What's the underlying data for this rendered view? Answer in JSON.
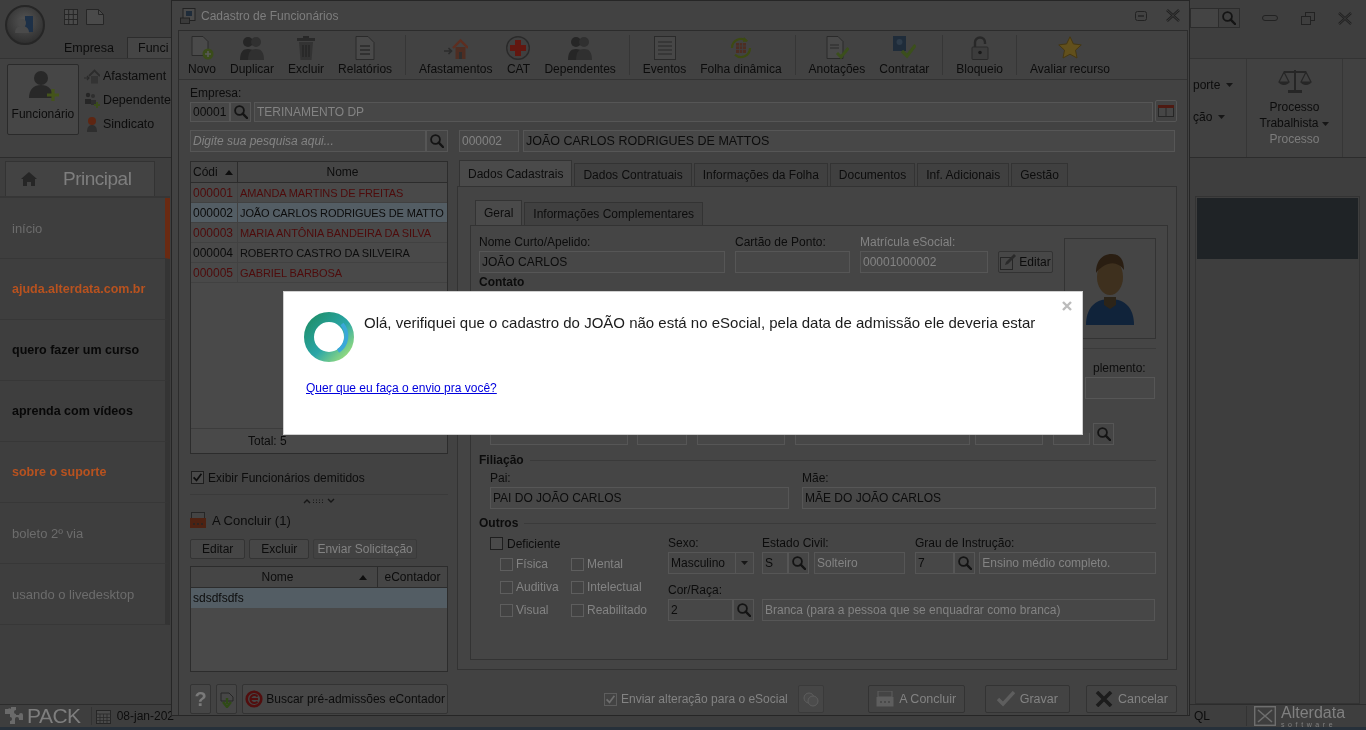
{
  "app": {
    "ribbon_tabs": [
      {
        "label": "Empresa",
        "selected": false
      },
      {
        "label": "Funci",
        "selected": true
      }
    ],
    "ribbon_left": {
      "main_button": "Funcionário",
      "items": [
        {
          "label": "Afastament",
          "kind": "leave"
        },
        {
          "label": "Dependente",
          "kind": "dependents"
        },
        {
          "label": "Sindicato",
          "kind": "union"
        }
      ]
    },
    "ribbon_right": {
      "menus": [
        "porte",
        "ção"
      ],
      "process_button": "Processo Trabalhista",
      "group_label": "Processo"
    },
    "page_tab": "Principal",
    "sidebar": {
      "items": [
        {
          "label": "início",
          "kind": "plain",
          "selected": true
        },
        {
          "label": "ajuda.alterdata.com.br",
          "kind": "accent",
          "selected": false
        },
        {
          "label": "quero fazer um curso",
          "kind": "bold",
          "selected": false
        },
        {
          "label": "aprenda com vídeos",
          "kind": "bold",
          "selected": false
        },
        {
          "label": "sobre o suporte",
          "kind": "accent",
          "selected": false
        },
        {
          "label": "boleto 2º via",
          "kind": "plain",
          "selected": false
        },
        {
          "label": "usando o livedesktop",
          "kind": "plain",
          "selected": false
        }
      ]
    },
    "status_bar": {
      "product": "PACK",
      "date": "08-jan-202",
      "database": "QL",
      "brand": "Alterdata",
      "brand_tagline": "software"
    }
  },
  "window": {
    "title": "Cadastro de Funcionários",
    "toolbar": [
      [
        {
          "label": "Novo",
          "kind": "new"
        },
        {
          "label": "Duplicar",
          "kind": "duplicate"
        },
        {
          "label": "Excluir",
          "kind": "delete"
        },
        {
          "label": "Relatórios",
          "kind": "report"
        }
      ],
      [
        {
          "label": "Afastamentos",
          "kind": "leave"
        },
        {
          "label": "CAT",
          "kind": "cat"
        },
        {
          "label": "Dependentes",
          "kind": "dependents"
        }
      ],
      [
        {
          "label": "Eventos",
          "kind": "events"
        },
        {
          "label": "Folha dinâmica",
          "kind": "payroll"
        }
      ],
      [
        {
          "label": "Anotações",
          "kind": "notes"
        },
        {
          "label": "Contratar",
          "kind": "hire"
        }
      ],
      [
        {
          "label": "Bloqueio",
          "kind": "lock"
        }
      ],
      [
        {
          "label": "Avaliar recurso",
          "kind": "rate"
        }
      ]
    ],
    "company": {
      "label": "Empresa:",
      "code": "00001",
      "name": "TERINAMENTO DP"
    },
    "search": {
      "placeholder": "Digite sua pesquisa aqui..."
    },
    "employees": {
      "columns": [
        {
          "label": "Códi",
          "sorted": true
        },
        {
          "label": "Nome",
          "sorted": false
        }
      ],
      "rows": [
        {
          "code": "000001",
          "name": "AMANDA MARTINS DE FREITAS",
          "color": "#4e0b0b",
          "selected": false
        },
        {
          "code": "000002",
          "name": "JOÃO CARLOS RODRIGUES DE MATTO",
          "color": "#0c0c0c",
          "selected": true
        },
        {
          "code": "000003",
          "name": "MARIA ANTÔNIA BANDEIRA DA SILVA",
          "color": "#4e0b0b",
          "selected": false
        },
        {
          "code": "000004",
          "name": "ROBERTO CASTRO DA SILVEIRA",
          "color": "#0c0c0c",
          "selected": false
        },
        {
          "code": "000005",
          "name": "GABRIEL BARBOSA",
          "color": "#4e0b0b",
          "selected": false
        }
      ],
      "total": "Total: 5"
    },
    "show_dismissed": {
      "label": "Exibir Funcionários demitidos",
      "checked": true
    },
    "pending": {
      "title": "A Concluir (1)",
      "buttons": [
        {
          "label": "Editar",
          "disabled": false
        },
        {
          "label": "Excluir",
          "disabled": false
        },
        {
          "label": "Enviar Solicitação",
          "disabled": true
        }
      ],
      "columns": [
        {
          "label": "Nome",
          "sorted": true
        },
        {
          "label": "eContador",
          "sorted": false
        }
      ],
      "rows": [
        {
          "name": "sdsdfsdfs",
          "selected": true
        }
      ]
    },
    "help_button": "?",
    "fetch_button": "Buscar pré-admissões eContador",
    "employee": {
      "code": "000002",
      "name": "JOÃO CARLOS RODRIGUES DE MATTOS"
    },
    "tabs": [
      {
        "label": "Dados Cadastrais",
        "selected": true
      },
      {
        "label": "Dados Contratuais",
        "selected": false
      },
      {
        "label": "Informações da Folha",
        "selected": false
      },
      {
        "label": "Documentos",
        "selected": false
      },
      {
        "label": "Inf. Adicionais",
        "selected": false
      },
      {
        "label": "Gestão",
        "selected": false
      }
    ],
    "subtabs": [
      {
        "label": "Geral",
        "selected": true
      },
      {
        "label": "Informações Complementares",
        "selected": false
      }
    ],
    "form": {
      "nickname": {
        "label": "Nome Curto/Apelido:",
        "value": "JOÃO CARLOS"
      },
      "time_card": {
        "label": "Cartão de Ponto:"
      },
      "esocial_id": {
        "label": "Matrícula eSocial:",
        "value": "00001000002",
        "disabled": true
      },
      "edit_button": "Editar",
      "contact_section": "Contato",
      "complement_label": "plemento:",
      "parents": {
        "title": "Filiação",
        "father": {
          "label": "Pai:",
          "value": "PAI DO JOÃO CARLOS"
        },
        "mother": {
          "label": "Mãe:",
          "value": "MÃE DO JOÃO CARLOS"
        }
      },
      "others": {
        "title": "Outros",
        "disability": {
          "label": "Deficiente",
          "checked": false
        },
        "disability_types": [
          {
            "label": "Física",
            "checked": false,
            "disabled": true
          },
          {
            "label": "Mental",
            "checked": false,
            "disabled": true
          },
          {
            "label": "Auditiva",
            "checked": false,
            "disabled": true
          },
          {
            "label": "Intelectual",
            "checked": false,
            "disabled": true
          },
          {
            "label": "Visual",
            "checked": false,
            "disabled": true
          },
          {
            "label": "Reabilitado",
            "checked": false,
            "disabled": true
          }
        ],
        "sex": {
          "label": "Sexo:",
          "value": "Masculino"
        },
        "marital_status": {
          "label": "Estado Civil:",
          "code": "S",
          "description": "Solteiro"
        },
        "education": {
          "label": "Grau de Instrução:",
          "code": "7",
          "description": "Ensino médio completo."
        },
        "race": {
          "label": "Cor/Raça:",
          "code": "2",
          "description": "Branca (para a pessoa que se enquadrar como branca)"
        }
      }
    },
    "footer": {
      "send_esocial": {
        "label": "Enviar alteração para o eSocial",
        "checked": true,
        "disabled": true
      },
      "buttons": [
        {
          "label": "A Concluir",
          "kind": "pending",
          "disabled": true
        },
        {
          "label": "Gravar",
          "kind": "save",
          "disabled": true
        },
        {
          "label": "Cancelar",
          "kind": "cancel",
          "disabled": true
        }
      ]
    }
  },
  "dialog": {
    "message": "Olá, verifiquei que o cadastro do JOÃO não está no eSocial, pela data de admissão ele deveria estar",
    "link": "Quer que eu faça o envio pra você?"
  }
}
